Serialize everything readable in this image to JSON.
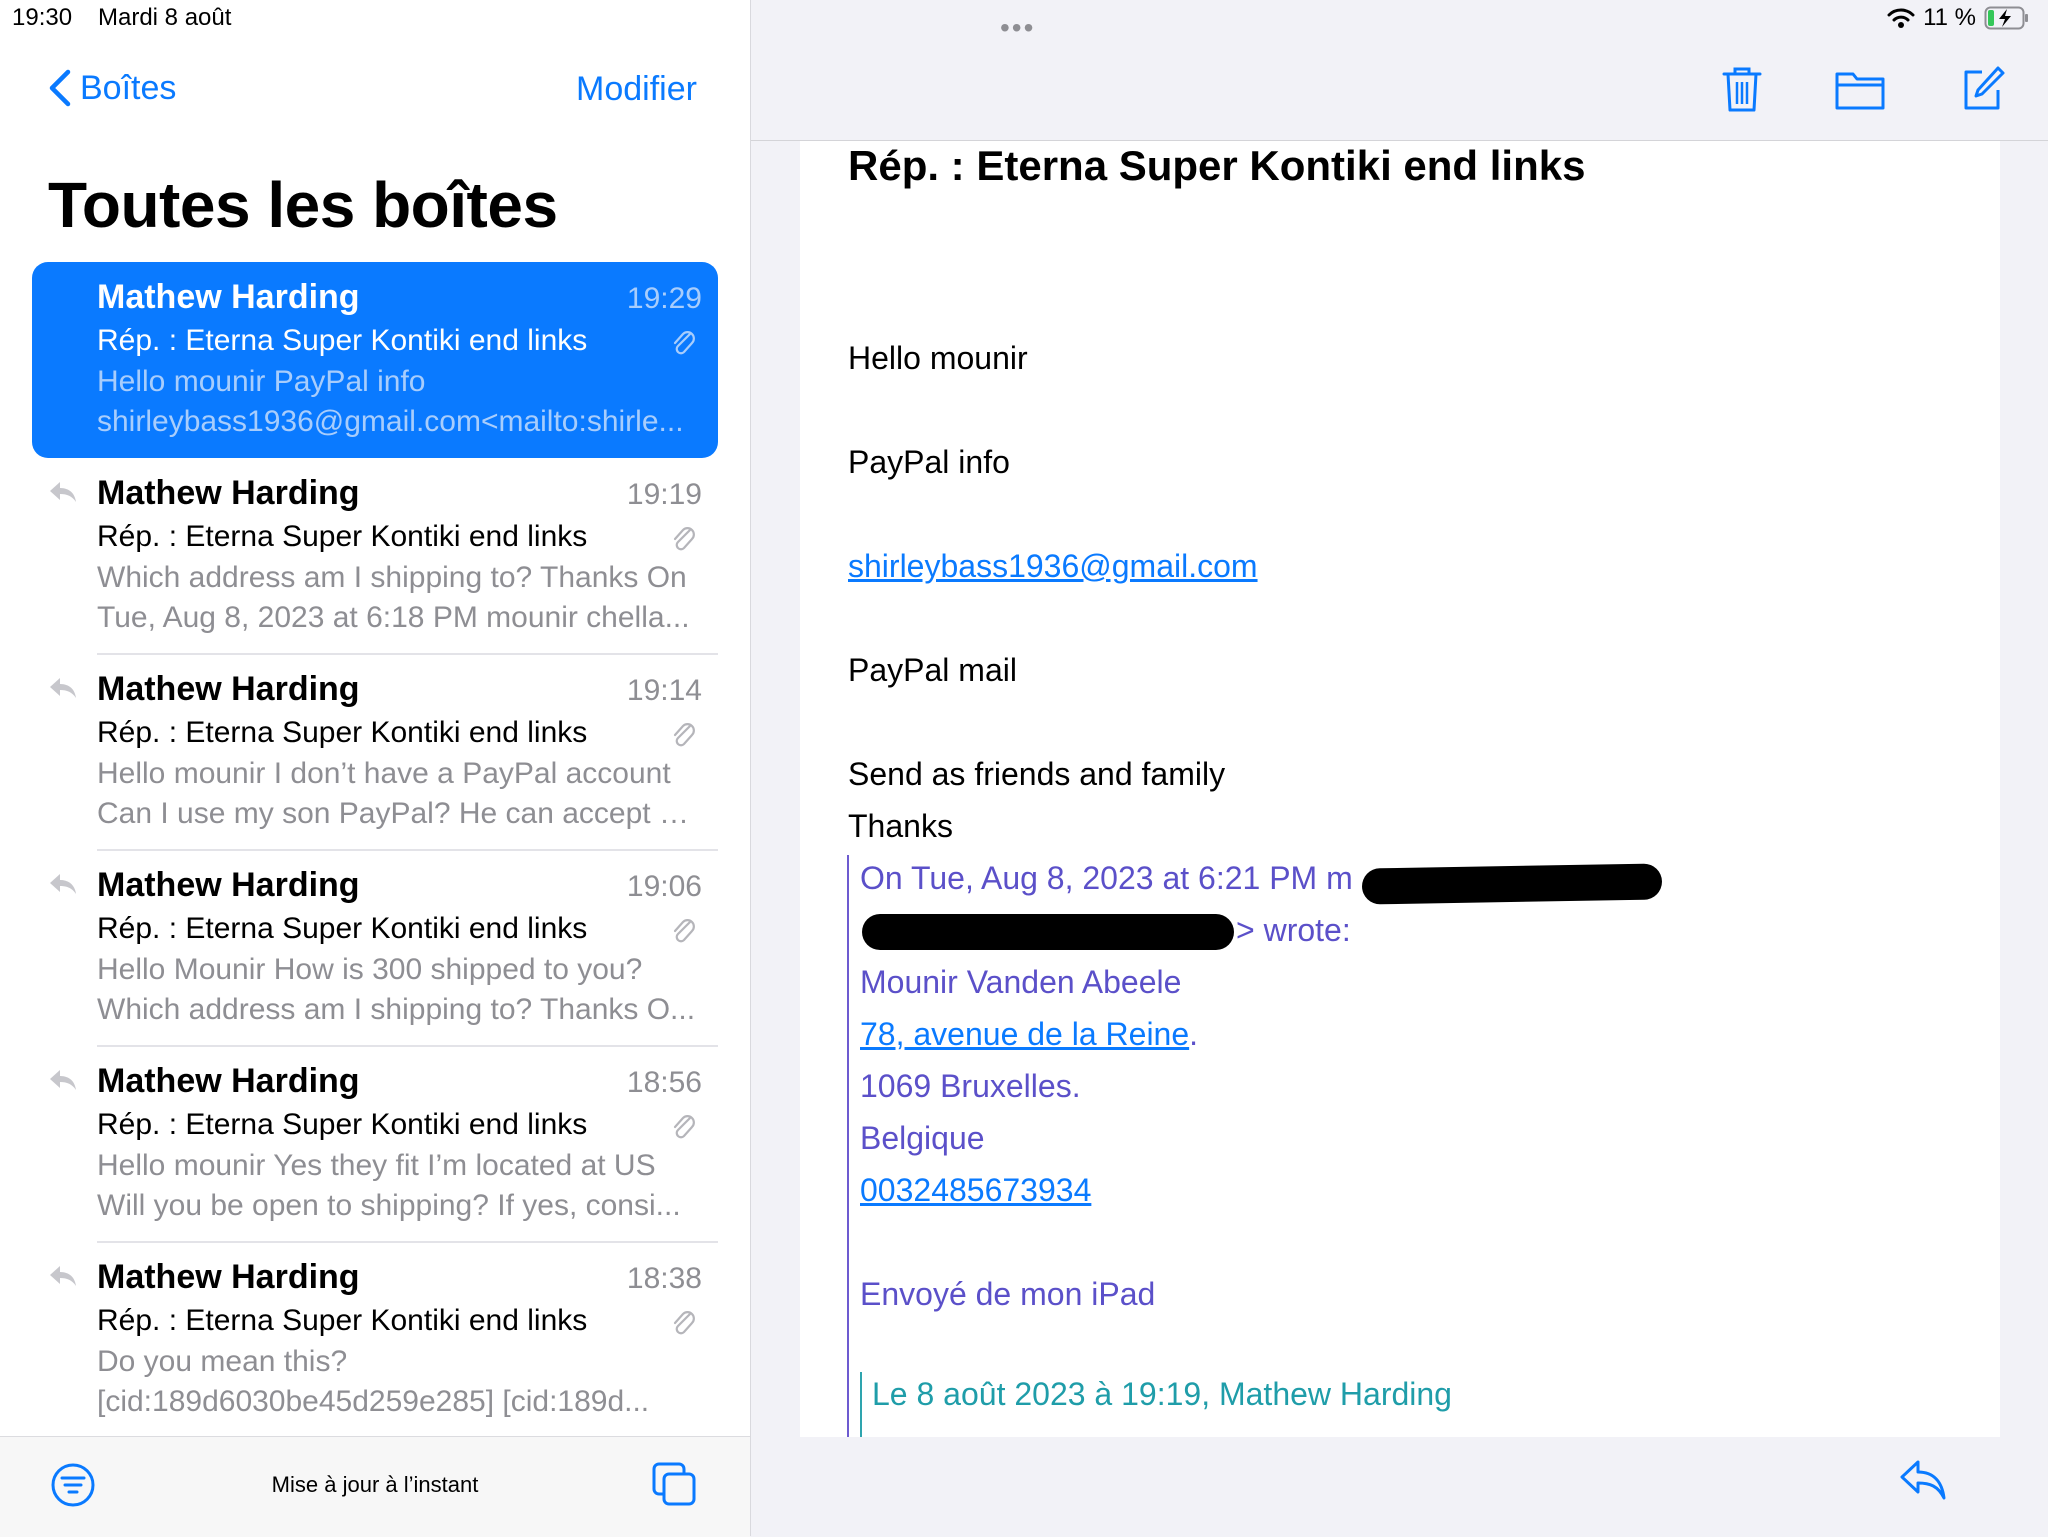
{
  "status": {
    "time": "19:30",
    "date": "Mardi 8 août",
    "battery": "11 %"
  },
  "left": {
    "back_label": "Boîtes",
    "edit_label": "Modifier",
    "title": "Toutes les boîtes",
    "update_status": "Mise à jour à l’instant"
  },
  "messages": [
    {
      "from": "Mathew Harding",
      "time": "19:29",
      "subject": "Rép. : Eterna Super Kontiki end links",
      "preview1": "Hello mounir PayPal info",
      "preview2": "shirleybass1936@gmail.com<mailto:shirle..."
    },
    {
      "from": "Mathew Harding",
      "time": "19:19",
      "subject": "Rép. : Eterna Super Kontiki end links",
      "preview1": "Which address am I shipping to? Thanks On",
      "preview2": "Tue, Aug 8, 2023 at 6:18 PM mounir chella..."
    },
    {
      "from": "Mathew Harding",
      "time": "19:14",
      "subject": "Rép. : Eterna Super Kontiki end links",
      "preview1": "Hello mounir I don’t have a PayPal account",
      "preview2": "Can I use my son PayPal? He can accept p..."
    },
    {
      "from": "Mathew Harding",
      "time": "19:06",
      "subject": "Rép. : Eterna Super Kontiki end links",
      "preview1": "Hello Mounir How is 300 shipped to you?",
      "preview2": "Which address am I shipping to? Thanks O..."
    },
    {
      "from": "Mathew Harding",
      "time": "18:56",
      "subject": "Rép. : Eterna Super Kontiki end links",
      "preview1": "Hello mounir Yes they fit I’m located at US",
      "preview2": "Will you be open to shipping? If yes, consi..."
    },
    {
      "from": "Mathew Harding",
      "time": "18:38",
      "subject": "Rép. : Eterna Super Kontiki end links",
      "preview1": "Do you mean this?",
      "preview2": "[cid:189d6030be45d259e285] [cid:189d..."
    }
  ],
  "email": {
    "subject": "Rép. : Eterna Super Kontiki end links",
    "greeting": "Hello mounir",
    "line_paypal_info": "PayPal info",
    "email_link": "shirleybass1936@gmail.com",
    "line_paypal_mail": "PayPal mail",
    "line_send": "Send as friends and family",
    "line_thanks": "Thanks",
    "quote_header1": "On Tue, Aug 8, 2023 at 6:21 PM m",
    "quote_header2": "> wrote:",
    "quote_name": "Mounir Vanden Abeele",
    "quote_street": "78, avenue de la Reine",
    "quote_street_end": ".",
    "quote_city": "1069 Bruxelles.",
    "quote_country": "Belgique",
    "quote_phone": "0032485673934",
    "quote_sent": "Envoyé de mon iPad",
    "quote2_header": "Le 8 août 2023 à 19:19, Mathew Harding"
  },
  "colors": {
    "accent": "#0a7aff",
    "quote_purple": "#5b50c9",
    "quote_teal": "#1f9da9"
  }
}
